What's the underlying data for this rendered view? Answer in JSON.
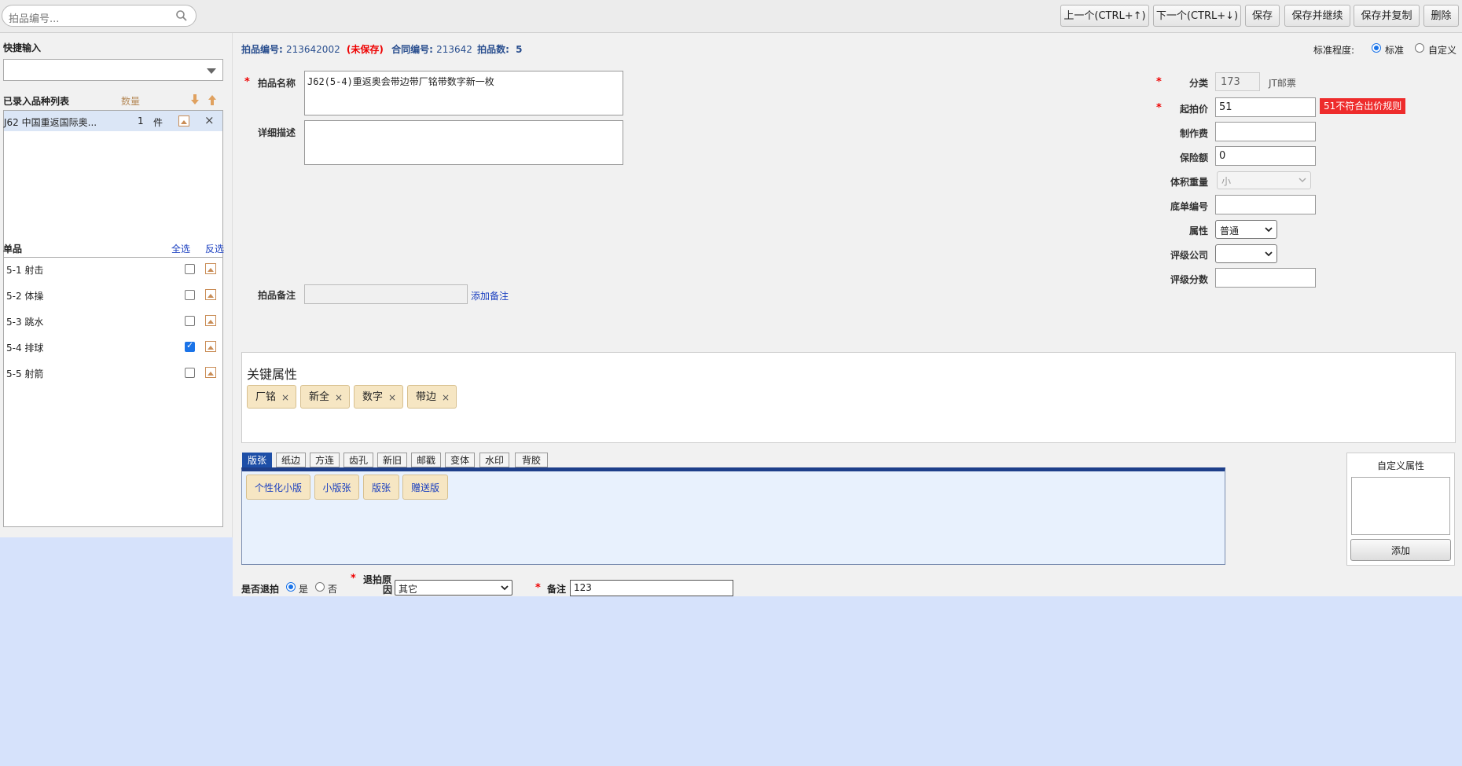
{
  "search": {
    "placeholder": "拍品编号..."
  },
  "toolbar": {
    "prev": "上一个(CTRL+↑)",
    "next": "下一个(CTRL+↓)",
    "save": "保存",
    "save_continue": "保存并继续",
    "save_copy": "保存并复制",
    "delete": "删除"
  },
  "left": {
    "quick_input_label": "快捷输入",
    "quick_input_value": "",
    "entered_list_label": "已录入品种列表",
    "qty_header": "数量",
    "entered_items": [
      {
        "name": "J62 中国重返国际奥...",
        "qty": "1",
        "unit": "件"
      }
    ],
    "single_label": "单品",
    "select_all": "全选",
    "invert": "反选",
    "singles": [
      {
        "name": "5-1 射击",
        "checked": false
      },
      {
        "name": "5-2 体操",
        "checked": false
      },
      {
        "name": "5-3 跳水",
        "checked": false
      },
      {
        "name": "5-4 排球",
        "checked": true
      },
      {
        "name": "5-5 射箭",
        "checked": false
      }
    ]
  },
  "info": {
    "lot_no_label": "拍品编号:",
    "lot_no": "213642002",
    "unsaved": "(未保存)",
    "contract_label": "合同编号:",
    "contract_no": "213642",
    "count_label": "拍品数:",
    "count": "5",
    "standard_label": "标准程度:",
    "standard_opt1": "标准",
    "standard_opt2": "自定义"
  },
  "form": {
    "name_label": "拍品名称",
    "name_value": "J62(5-4)重返奥会带边带厂铭带数字新一枚",
    "desc_label": "详细描述",
    "desc_value": "",
    "remark_label": "拍品备注",
    "remark_value": "",
    "add_remark": "添加备注",
    "category_label": "分类",
    "category_value": "173",
    "category_name": "JT邮票",
    "start_price_label": "起拍价",
    "start_price_value": "51",
    "price_error": "51不符合出价规则",
    "make_fee_label": "制作费",
    "make_fee_value": "",
    "insure_label": "保险额",
    "insure_value": "0",
    "volume_label": "体积重量",
    "volume_value": "小",
    "bill_label": "底单编号",
    "bill_value": "",
    "attr_label": "属性",
    "attr_value": "普通",
    "grade_co_label": "评级公司",
    "grade_co_value": "",
    "grade_score_label": "评级分数",
    "grade_score_value": ""
  },
  "key_attrs": {
    "title": "关键属性",
    "tags": [
      "厂铭",
      "新全",
      "数字",
      "带边"
    ]
  },
  "tabs": [
    "版张",
    "纸边",
    "方连",
    "齿孔",
    "新旧",
    "邮戳",
    "变体",
    "水印",
    "背胶"
  ],
  "tab_items": [
    "个性化小版",
    "小版张",
    "版张",
    "赠送版"
  ],
  "custom_attr": {
    "title": "自定义属性",
    "add": "添加"
  },
  "bottom": {
    "return_label": "是否退拍",
    "yes": "是",
    "no": "否",
    "reason_label_1": "退拍原",
    "reason_label_2": "因",
    "reason_value": "其它",
    "note_label": "备注",
    "note_value": "123"
  }
}
